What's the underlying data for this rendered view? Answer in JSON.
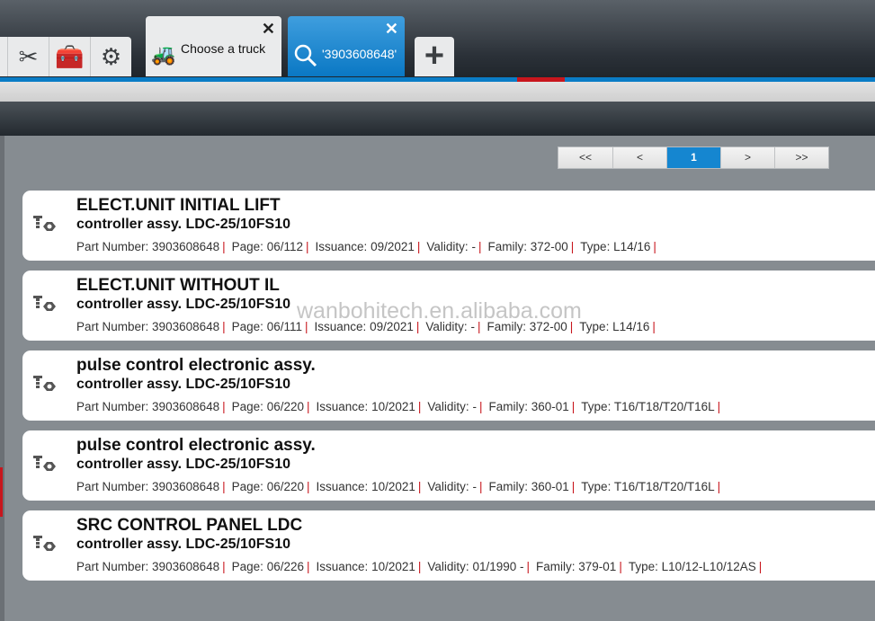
{
  "toolbar": {
    "icons": [
      "tools-icon",
      "toolbox-icon",
      "gear-icon"
    ]
  },
  "tabs": [
    {
      "label": "Choose a truck",
      "icon": "forklift-icon",
      "close": "✕"
    },
    {
      "label": "'3903608648'",
      "icon": "search-icon",
      "close": "✕"
    }
  ],
  "add_tab": "+",
  "pager": {
    "first": "<<",
    "prev": "<",
    "current": "1",
    "next": ">",
    "last": ">>"
  },
  "labels": {
    "part": "Part Number:",
    "page": "Page:",
    "issuance": "Issuance:",
    "validity": "Validity:",
    "family": "Family:",
    "type": "Type:",
    "sep": "|"
  },
  "results": [
    {
      "title": "ELECT.UNIT INITIAL LIFT",
      "subtitle": "controller assy.  LDC-25/10FS10",
      "part": "3903608648",
      "page": "06/112",
      "issuance": "09/2021",
      "validity": "-",
      "family": "372-00",
      "type": "L14/16"
    },
    {
      "title": "ELECT.UNIT WITHOUT IL",
      "subtitle": "controller assy.  LDC-25/10FS10",
      "part": "3903608648",
      "page": "06/111",
      "issuance": "09/2021",
      "validity": "-",
      "family": "372-00",
      "type": "L14/16"
    },
    {
      "title": "pulse control electronic assy.",
      "subtitle": "controller assy.  LDC-25/10FS10",
      "part": "3903608648",
      "page": "06/220",
      "issuance": "10/2021",
      "validity": "-",
      "family": "360-01",
      "type": "T16/T18/T20/T16L"
    },
    {
      "title": "pulse control electronic assy.",
      "subtitle": "controller assy.  LDC-25/10FS10",
      "part": "3903608648",
      "page": "06/220",
      "issuance": "10/2021",
      "validity": "-",
      "family": "360-01",
      "type": "T16/T18/T20/T16L"
    },
    {
      "title": "SRC CONTROL PANEL LDC",
      "subtitle": "controller assy.  LDC-25/10FS10",
      "part": "3903608648",
      "page": "06/226",
      "issuance": "10/2021",
      "validity": "01/1990 -",
      "family": "379-01",
      "type": "L10/12-L10/12AS"
    }
  ],
  "watermark": "wanbohitech.en.alibaba.com"
}
